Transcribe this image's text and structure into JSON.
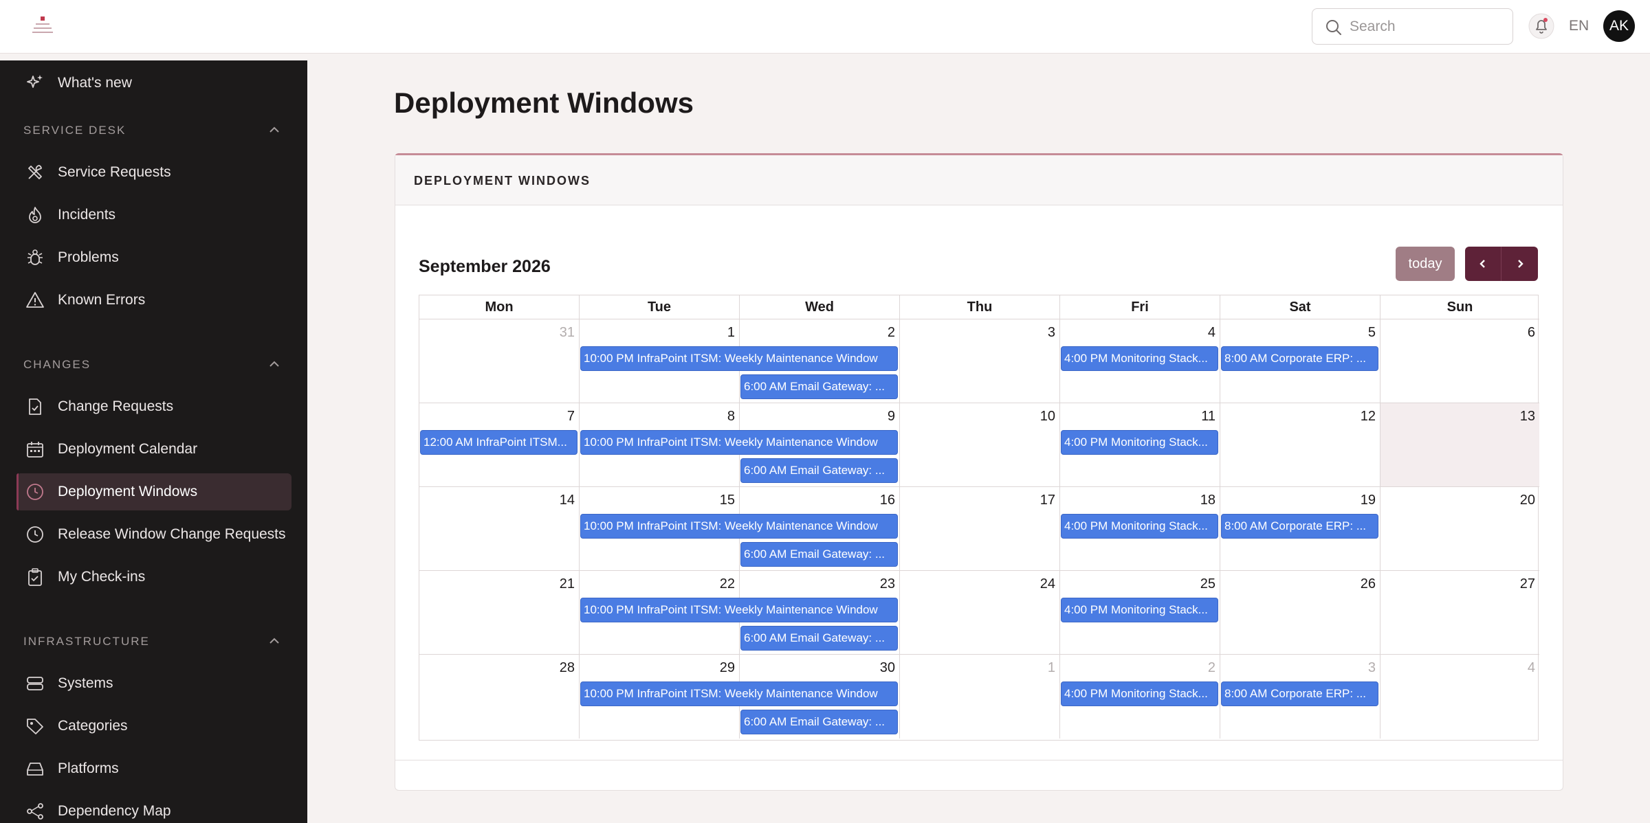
{
  "header": {
    "search_placeholder": "Search",
    "lang": "EN",
    "avatar_initials": "AK"
  },
  "sidebar": {
    "whats_new": "What's new",
    "sections": [
      {
        "title": "SERVICE DESK",
        "items": [
          "Service Requests",
          "Incidents",
          "Problems",
          "Known Errors"
        ]
      },
      {
        "title": "CHANGES",
        "items": [
          "Change Requests",
          "Deployment Calendar",
          "Deployment Windows",
          "Release Window Change Requests",
          "My Check-ins"
        ]
      },
      {
        "title": "INFRASTRUCTURE",
        "items": [
          "Systems",
          "Categories",
          "Platforms",
          "Dependency Map"
        ]
      }
    ],
    "active_item": "Deployment Windows"
  },
  "page": {
    "title": "Deployment Windows",
    "card_title": "DEPLOYMENT WINDOWS"
  },
  "calendar": {
    "month_label": "September 2026",
    "today_label": "today",
    "weekdays": [
      "Mon",
      "Tue",
      "Wed",
      "Thu",
      "Fri",
      "Sat",
      "Sun"
    ],
    "weeks": [
      [
        "31",
        "1",
        "2",
        "3",
        "4",
        "5",
        "6"
      ],
      [
        "7",
        "8",
        "9",
        "10",
        "11",
        "12",
        "13"
      ],
      [
        "14",
        "15",
        "16",
        "17",
        "18",
        "19",
        "20"
      ],
      [
        "21",
        "22",
        "23",
        "24",
        "25",
        "26",
        "27"
      ],
      [
        "28",
        "29",
        "30",
        "1",
        "2",
        "3",
        "4"
      ]
    ],
    "other_month": [
      [
        0
      ],
      [],
      [],
      [],
      [
        3,
        4,
        5,
        6
      ]
    ],
    "today_cell": [
      1,
      6
    ],
    "events": [
      {
        "week": 0,
        "day": 1,
        "span": 2,
        "row": 0,
        "text": "10:00 PM InfraPoint ITSM: Weekly Maintenance Window"
      },
      {
        "week": 0,
        "day": 2,
        "span": 1,
        "row": 1,
        "text": "6:00 AM Email Gateway: ..."
      },
      {
        "week": 0,
        "day": 4,
        "span": 1,
        "row": 0,
        "text": "4:00 PM Monitoring Stack..."
      },
      {
        "week": 0,
        "day": 5,
        "span": 1,
        "row": 0,
        "text": "8:00 AM Corporate ERP: ..."
      },
      {
        "week": 1,
        "day": 0,
        "span": 1,
        "row": 0,
        "text": "12:00 AM InfraPoint ITSM..."
      },
      {
        "week": 1,
        "day": 1,
        "span": 2,
        "row": 0,
        "text": "10:00 PM InfraPoint ITSM: Weekly Maintenance Window"
      },
      {
        "week": 1,
        "day": 2,
        "span": 1,
        "row": 1,
        "text": "6:00 AM Email Gateway: ..."
      },
      {
        "week": 1,
        "day": 4,
        "span": 1,
        "row": 0,
        "text": "4:00 PM Monitoring Stack..."
      },
      {
        "week": 2,
        "day": 1,
        "span": 2,
        "row": 0,
        "text": "10:00 PM InfraPoint ITSM: Weekly Maintenance Window"
      },
      {
        "week": 2,
        "day": 2,
        "span": 1,
        "row": 1,
        "text": "6:00 AM Email Gateway: ..."
      },
      {
        "week": 2,
        "day": 4,
        "span": 1,
        "row": 0,
        "text": "4:00 PM Monitoring Stack..."
      },
      {
        "week": 2,
        "day": 5,
        "span": 1,
        "row": 0,
        "text": "8:00 AM Corporate ERP: ..."
      },
      {
        "week": 3,
        "day": 1,
        "span": 2,
        "row": 0,
        "text": "10:00 PM InfraPoint ITSM: Weekly Maintenance Window"
      },
      {
        "week": 3,
        "day": 2,
        "span": 1,
        "row": 1,
        "text": "6:00 AM Email Gateway: ..."
      },
      {
        "week": 3,
        "day": 4,
        "span": 1,
        "row": 0,
        "text": "4:00 PM Monitoring Stack..."
      },
      {
        "week": 4,
        "day": 1,
        "span": 2,
        "row": 0,
        "text": "10:00 PM InfraPoint ITSM: Weekly Maintenance Window"
      },
      {
        "week": 4,
        "day": 2,
        "span": 1,
        "row": 1,
        "text": "6:00 AM Email Gateway: ..."
      },
      {
        "week": 4,
        "day": 4,
        "span": 1,
        "row": 0,
        "text": "4:00 PM Monitoring Stack..."
      },
      {
        "week": 4,
        "day": 5,
        "span": 1,
        "row": 0,
        "text": "8:00 AM Corporate ERP: ..."
      }
    ]
  }
}
